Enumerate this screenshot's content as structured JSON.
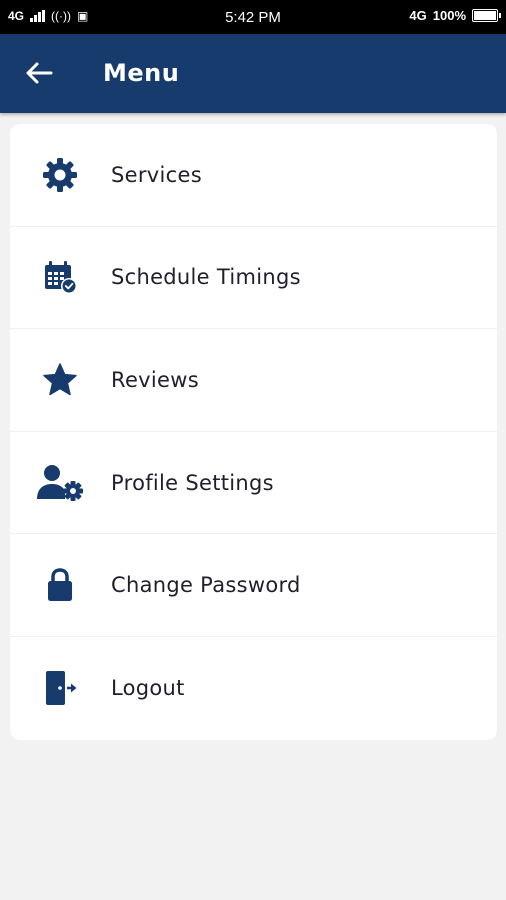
{
  "status_bar": {
    "network_left": "4G",
    "time": "5:42 PM",
    "network_right": "4G",
    "battery": "100%"
  },
  "app_bar": {
    "title": "Menu",
    "back_icon": "arrow-left-icon"
  },
  "menu": {
    "items": [
      {
        "label": "Services",
        "icon": "gear-icon"
      },
      {
        "label": "Schedule Timings",
        "icon": "calendar-check-icon"
      },
      {
        "label": "Reviews",
        "icon": "star-icon"
      },
      {
        "label": "Profile Settings",
        "icon": "user-gear-icon"
      },
      {
        "label": "Change Password",
        "icon": "lock-icon"
      },
      {
        "label": "Logout",
        "icon": "logout-door-icon"
      }
    ]
  },
  "colors": {
    "primary": "#173b6c",
    "background": "#f2f2f2",
    "text": "#1f1f2e"
  }
}
